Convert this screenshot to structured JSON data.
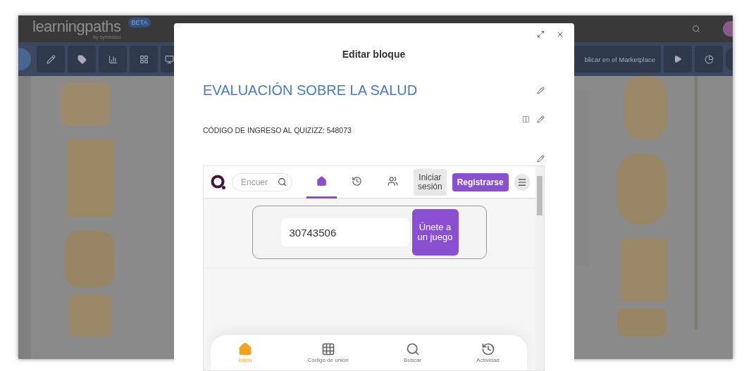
{
  "app_bar": {
    "logo": "learningpaths",
    "logo_sub": "by symbaloo",
    "badge": "BETA"
  },
  "toolbar": {
    "publish_label": "blicar en el Marketplace"
  },
  "modal": {
    "title": "Editar bloque",
    "heading": "EVALUACIÓN SOBRE LA SALUD",
    "text": "CÓDIGO DE INGRESO AL QUIZIZZ: 548073",
    "embed": {
      "search_placeholder": "Encuer",
      "nav_tabs": [
        {
          "kind": "home",
          "selected": true
        },
        {
          "kind": "history",
          "selected": false
        },
        {
          "kind": "group",
          "selected": false
        }
      ],
      "login": "Iniciar sesión",
      "register": "Registrarse",
      "code_value": "30743506",
      "join": "Únete a un juego",
      "bottom_nav": [
        {
          "kind": "home",
          "label": "Inicio",
          "selected": true
        },
        {
          "kind": "keypad",
          "label": "Código de unión",
          "selected": false
        },
        {
          "kind": "search",
          "label": "Buscar",
          "selected": false
        },
        {
          "kind": "history",
          "label": "Actividad",
          "selected": false
        }
      ]
    }
  }
}
